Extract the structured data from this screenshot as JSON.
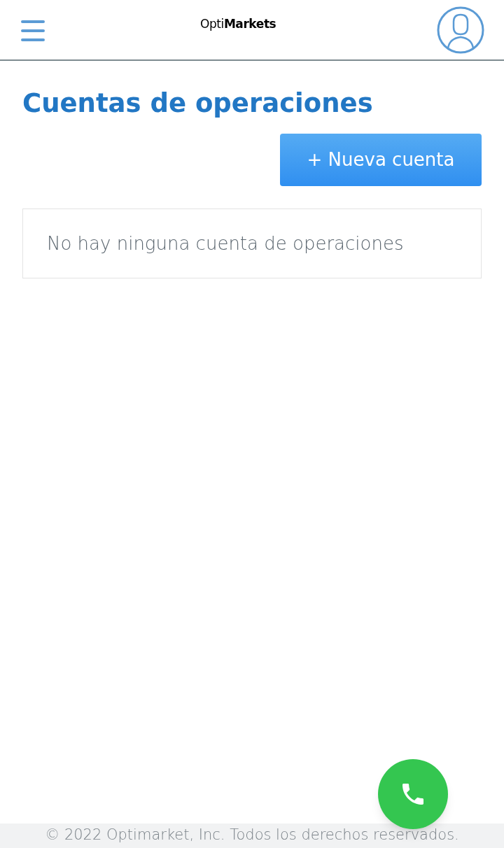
{
  "header": {
    "logo": "Opti**Markets**"
  },
  "page": {
    "title": "Cuentas de operaciones",
    "new_button": "+ Nueva cuenta",
    "empty_message": "No hay ninguna cuenta de operaciones"
  },
  "footer": {
    "text": "© 2022 Optimarket, Inc. Todos los derechos reservados."
  }
}
